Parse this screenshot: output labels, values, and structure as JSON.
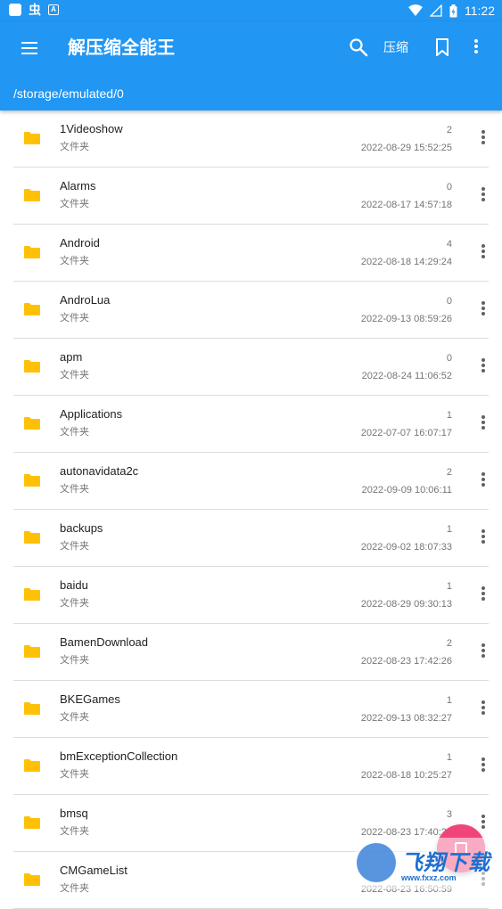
{
  "status_bar": {
    "time": "11:22",
    "left_icons": [
      "app-square-icon",
      "bug-icon",
      "notification-a-icon"
    ],
    "right_icons": [
      "wifi-icon",
      "signal-icon",
      "battery-icon"
    ]
  },
  "app_bar": {
    "title": "解压缩全能王",
    "compress_label": "压缩",
    "path": "/storage/emulated/0",
    "color": "#2196f3"
  },
  "colors": {
    "folder": "#ffc107",
    "fab": "#f0457a"
  },
  "files": [
    {
      "name": "1Videoshow",
      "type": "文件夹",
      "count": "2",
      "date": "2022-08-29 15:52:25"
    },
    {
      "name": "Alarms",
      "type": "文件夹",
      "count": "0",
      "date": "2022-08-17 14:57:18"
    },
    {
      "name": "Android",
      "type": "文件夹",
      "count": "4",
      "date": "2022-08-18 14:29:24"
    },
    {
      "name": "AndroLua",
      "type": "文件夹",
      "count": "0",
      "date": "2022-09-13 08:59:26"
    },
    {
      "name": "apm",
      "type": "文件夹",
      "count": "0",
      "date": "2022-08-24 11:06:52"
    },
    {
      "name": "Applications",
      "type": "文件夹",
      "count": "1",
      "date": "2022-07-07 16:07:17"
    },
    {
      "name": "autonavidata2c",
      "type": "文件夹",
      "count": "2",
      "date": "2022-09-09 10:06:11"
    },
    {
      "name": "backups",
      "type": "文件夹",
      "count": "1",
      "date": "2022-09-02 18:07:33"
    },
    {
      "name": "baidu",
      "type": "文件夹",
      "count": "1",
      "date": "2022-08-29 09:30:13"
    },
    {
      "name": "BamenDownload",
      "type": "文件夹",
      "count": "2",
      "date": "2022-08-23 17:42:26"
    },
    {
      "name": "BKEGames",
      "type": "文件夹",
      "count": "1",
      "date": "2022-09-13 08:32:27"
    },
    {
      "name": "bmExceptionCollection",
      "type": "文件夹",
      "count": "1",
      "date": "2022-08-18 10:25:27"
    },
    {
      "name": "bmsq",
      "type": "文件夹",
      "count": "3",
      "date": "2022-08-23 17:40:20"
    },
    {
      "name": "CMGameList",
      "type": "文件夹",
      "count": "",
      "date": "2022-08-23 16:50:59"
    }
  ],
  "watermark": {
    "text": "飞翔下载",
    "url": "www.fxxz.com"
  }
}
